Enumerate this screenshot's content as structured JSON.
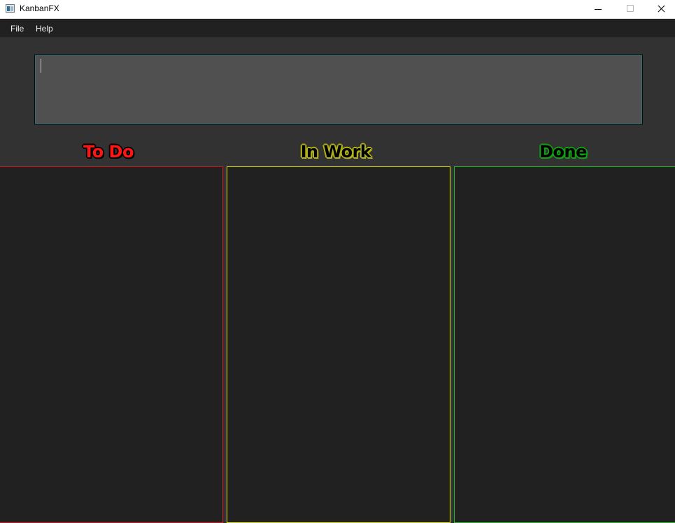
{
  "window": {
    "title": "KanbanFX",
    "icon": "app-icon",
    "controls": [
      "minimize-icon",
      "maximize-icon",
      "close-icon"
    ]
  },
  "menu": {
    "file_label": "File",
    "help_label": "Help"
  },
  "task_input": {
    "value": "",
    "placeholder": ""
  },
  "columns": [
    {
      "title": "To Do",
      "color": "#ff1515",
      "border_color": "#d01a1a",
      "cards": []
    },
    {
      "title": "In Work",
      "color": "#b3b31a",
      "border_color": "#e6e600",
      "cards": []
    },
    {
      "title": "Done",
      "color": "#12a012",
      "border_color": "#22c822",
      "cards": []
    }
  ],
  "colors": {
    "background": "#323232",
    "menubar": "#212121",
    "column_background": "#212121",
    "input_background": "#505050"
  }
}
